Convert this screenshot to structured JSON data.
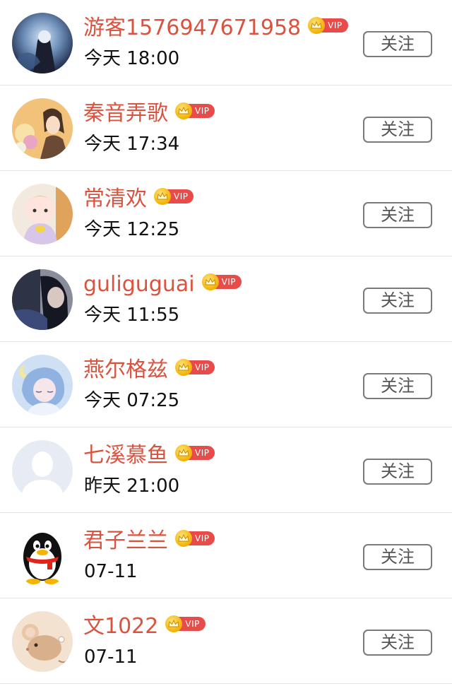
{
  "vip_label": "VIP",
  "follow_label": "关注",
  "colors": {
    "name": "#d9533f",
    "vip_tag": "#e84c4a",
    "crown": "#f2b100"
  },
  "users": [
    {
      "name": "游客1576947671958",
      "time": "今天 18:00",
      "avatar": "anime-night-avatar"
    },
    {
      "name": "秦音弄歌",
      "time": "今天 17:34",
      "avatar": "anime-flowers-avatar"
    },
    {
      "name": "常清欢",
      "time": "今天 12:25",
      "avatar": "anime-baby-avatar"
    },
    {
      "name": "guliguguai",
      "time": "今天 11:55",
      "avatar": "photo-girl-avatar"
    },
    {
      "name": "燕尔格兹",
      "time": "今天 07:25",
      "avatar": "anime-blue-hair-avatar"
    },
    {
      "name": "七溪慕鱼",
      "time": "昨天 21:00",
      "avatar": "default-user-avatar"
    },
    {
      "name": "君子兰兰",
      "time": "07-11",
      "avatar": "qq-penguin-avatar"
    },
    {
      "name": "文1022",
      "time": "07-11",
      "avatar": "cartoon-mouse-avatar"
    }
  ]
}
